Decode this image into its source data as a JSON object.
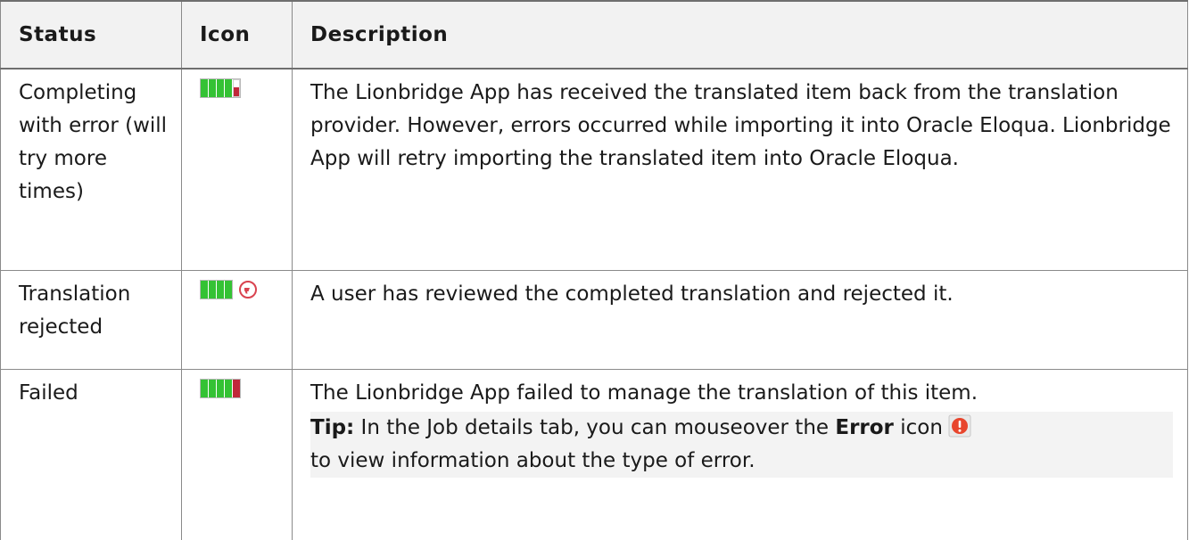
{
  "headers": {
    "status": "Status",
    "icon": "Icon",
    "description": "Description"
  },
  "rows": [
    {
      "status": "Completing with error (will try more times)",
      "icon": "progress-bar-completing-error-icon",
      "description": "The Lionbridge App has received the translated item back from the translation provider. However, errors occurred while importing it into Oracle Eloqua. Lionbridge App will retry importing the translated item into Oracle Eloqua."
    },
    {
      "status": "Translation rejected",
      "icon": "progress-bar-rejected-icon",
      "description": "A user has reviewed the completed translation and rejected it."
    },
    {
      "status": "Failed",
      "icon": "progress-bar-failed-icon",
      "description": "The Lionbridge App failed to manage the translation of this item.",
      "tip": {
        "label": "Tip:",
        "text_before": "In the Job details tab, you can mouseover the",
        "emphasis": "Error",
        "text_middle": "icon",
        "text_after": "to view information about the type of error.",
        "icon": "error-icon"
      }
    }
  ],
  "colors": {
    "progress_green": "#34c234",
    "error_red": "#c0283a",
    "header_bg": "#f2f2f2",
    "tip_bg": "#f3f3f3"
  }
}
